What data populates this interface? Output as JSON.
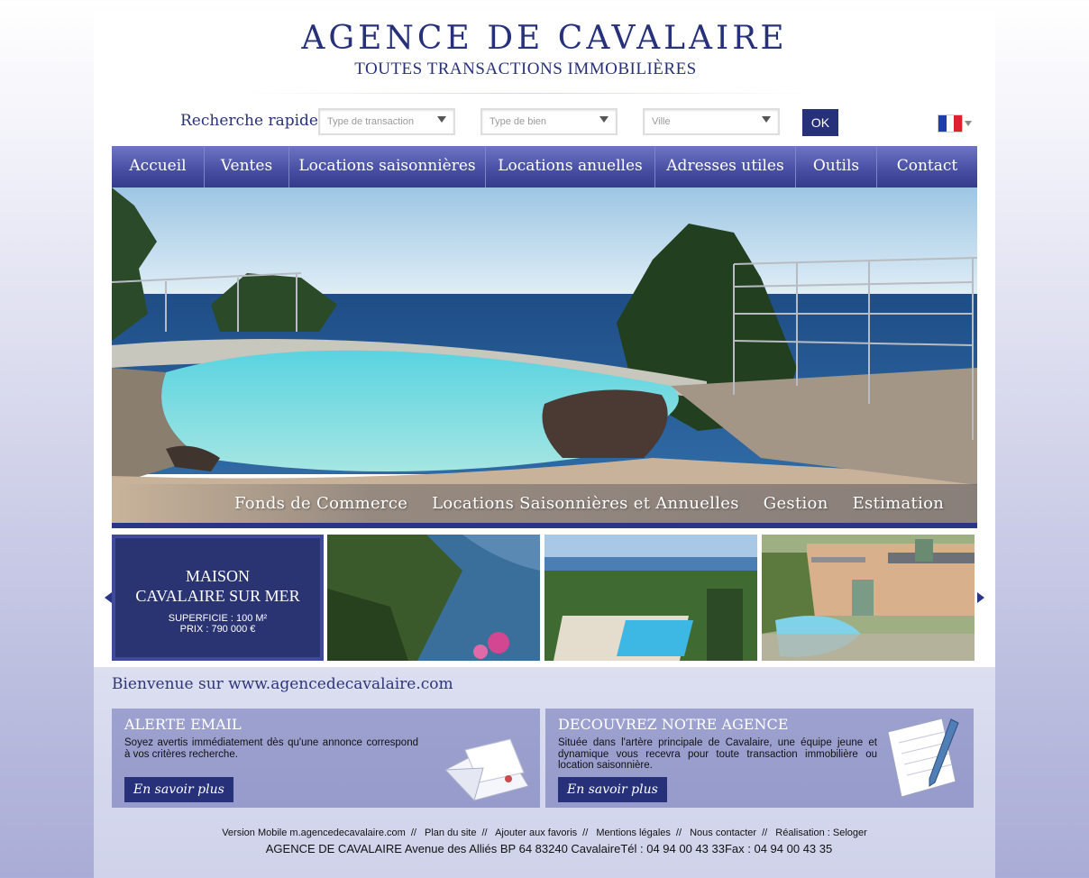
{
  "header": {
    "title": "AGENCE DE CAVALAIRE",
    "subtitle": "TOUTES TRANSACTIONS IMMOBILIÈRES"
  },
  "search": {
    "label": "Recherche rapide",
    "transaction_placeholder": "Type de transaction",
    "property_placeholder": "Type de bien",
    "city_placeholder": "Ville",
    "ok_label": "OK",
    "language": "fr"
  },
  "nav": {
    "items": [
      {
        "label": "Accueil"
      },
      {
        "label": "Ventes"
      },
      {
        "label": "Locations saisonnières"
      },
      {
        "label": "Locations anuelles"
      },
      {
        "label": "Adresses utiles"
      },
      {
        "label": "Outils"
      },
      {
        "label": "Contact"
      }
    ]
  },
  "hero": {
    "links": [
      {
        "label": "Fonds de Commerce"
      },
      {
        "label": "Locations Saisonnières et Annuelles"
      },
      {
        "label": "Gestion"
      },
      {
        "label": "Estimation"
      }
    ]
  },
  "featured": {
    "type": "MAISON",
    "location": "CAVALAIRE SUR MER",
    "surface": "SUPERFICIE : 100 M²",
    "price": "PRIX : 790 000 €"
  },
  "welcome": "Bienvenue sur www.agencedecavalaire.com",
  "panels": {
    "alert": {
      "title": "ALERTE EMAIL",
      "text": "Soyez avertis immédiatement dès qu'une annonce correspond à vos critères recherche.",
      "button": "En savoir plus"
    },
    "agency": {
      "title": "DECOUVREZ NOTRE AGENCE",
      "text": "Située dans l'artère principale de Cavalaire, une équipe jeune et dynamique vous recevra pour toute transaction immobilière ou location saisonnière.",
      "button": "En savoir plus"
    }
  },
  "footer": {
    "links": [
      {
        "label": "Version Mobile m.agencedecavalaire.com"
      },
      {
        "label": "Plan du site"
      },
      {
        "label": "Ajouter aux favoris"
      },
      {
        "label": "Mentions légales"
      },
      {
        "label": "Nous contacter"
      },
      {
        "label": "Réalisation : Seloger"
      }
    ],
    "address": "AGENCE DE CAVALAIRE Avenue des Alliés BP 64 83240 CavalaireTél : 04 94 00 43 33Fax : 04 94 00 43 35"
  },
  "colors": {
    "brand": "#27317a",
    "nav_top": "#6f75c3",
    "nav_bottom": "#343b8d",
    "panel": "#9da1cf"
  }
}
